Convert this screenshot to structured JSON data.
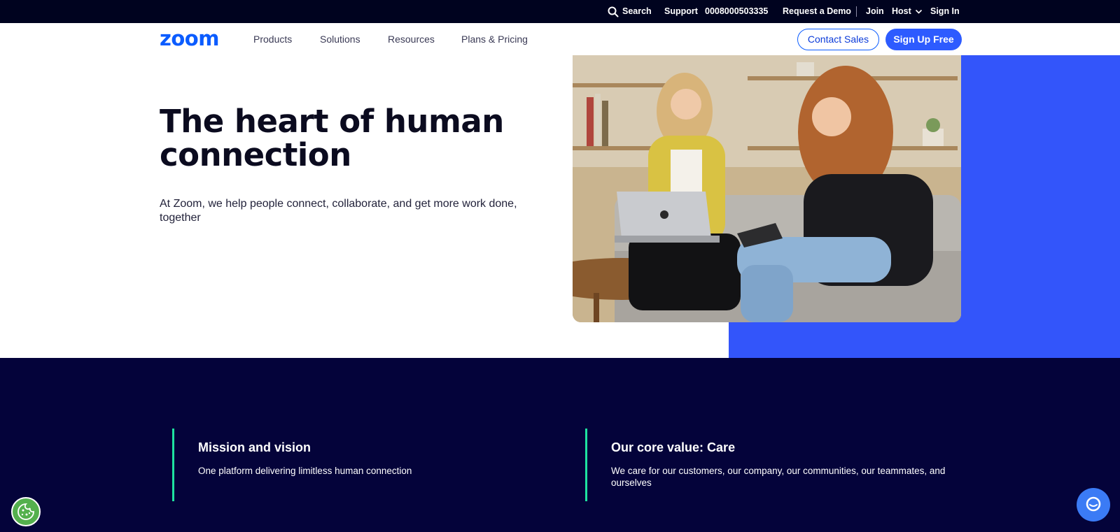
{
  "utility_bar": {
    "search_label": "Search",
    "support_label": "Support",
    "phone": "0008000503335",
    "demo_label": "Request a Demo",
    "join_label": "Join",
    "host_label": "Host",
    "signin_label": "Sign In"
  },
  "nav": {
    "logo_text": "zoom",
    "links": [
      "Products",
      "Solutions",
      "Resources",
      "Plans & Pricing"
    ],
    "contact_label": "Contact Sales",
    "signup_label": "Sign Up Free"
  },
  "hero": {
    "title_line1": "The heart of human",
    "title_line2": "connection",
    "subtitle": "At Zoom, we help people connect, collaborate, and get more work done, together"
  },
  "values": [
    {
      "title": "Mission and vision",
      "text": "One platform delivering limitless human connection"
    },
    {
      "title": "Our core value: Care",
      "text": "We care for our customers, our company, our communities, our teammates, and ourselves"
    }
  ],
  "colors": {
    "brand_blue": "#0b5cff",
    "hero_blue": "#3355fa",
    "dark_navy": "#04033a",
    "accent_green": "#1ee3a0"
  },
  "icons": {
    "search": "search-icon",
    "host_dropdown": "chevron-down-icon",
    "cookie": "cookie-icon",
    "chat": "chat-icon"
  }
}
